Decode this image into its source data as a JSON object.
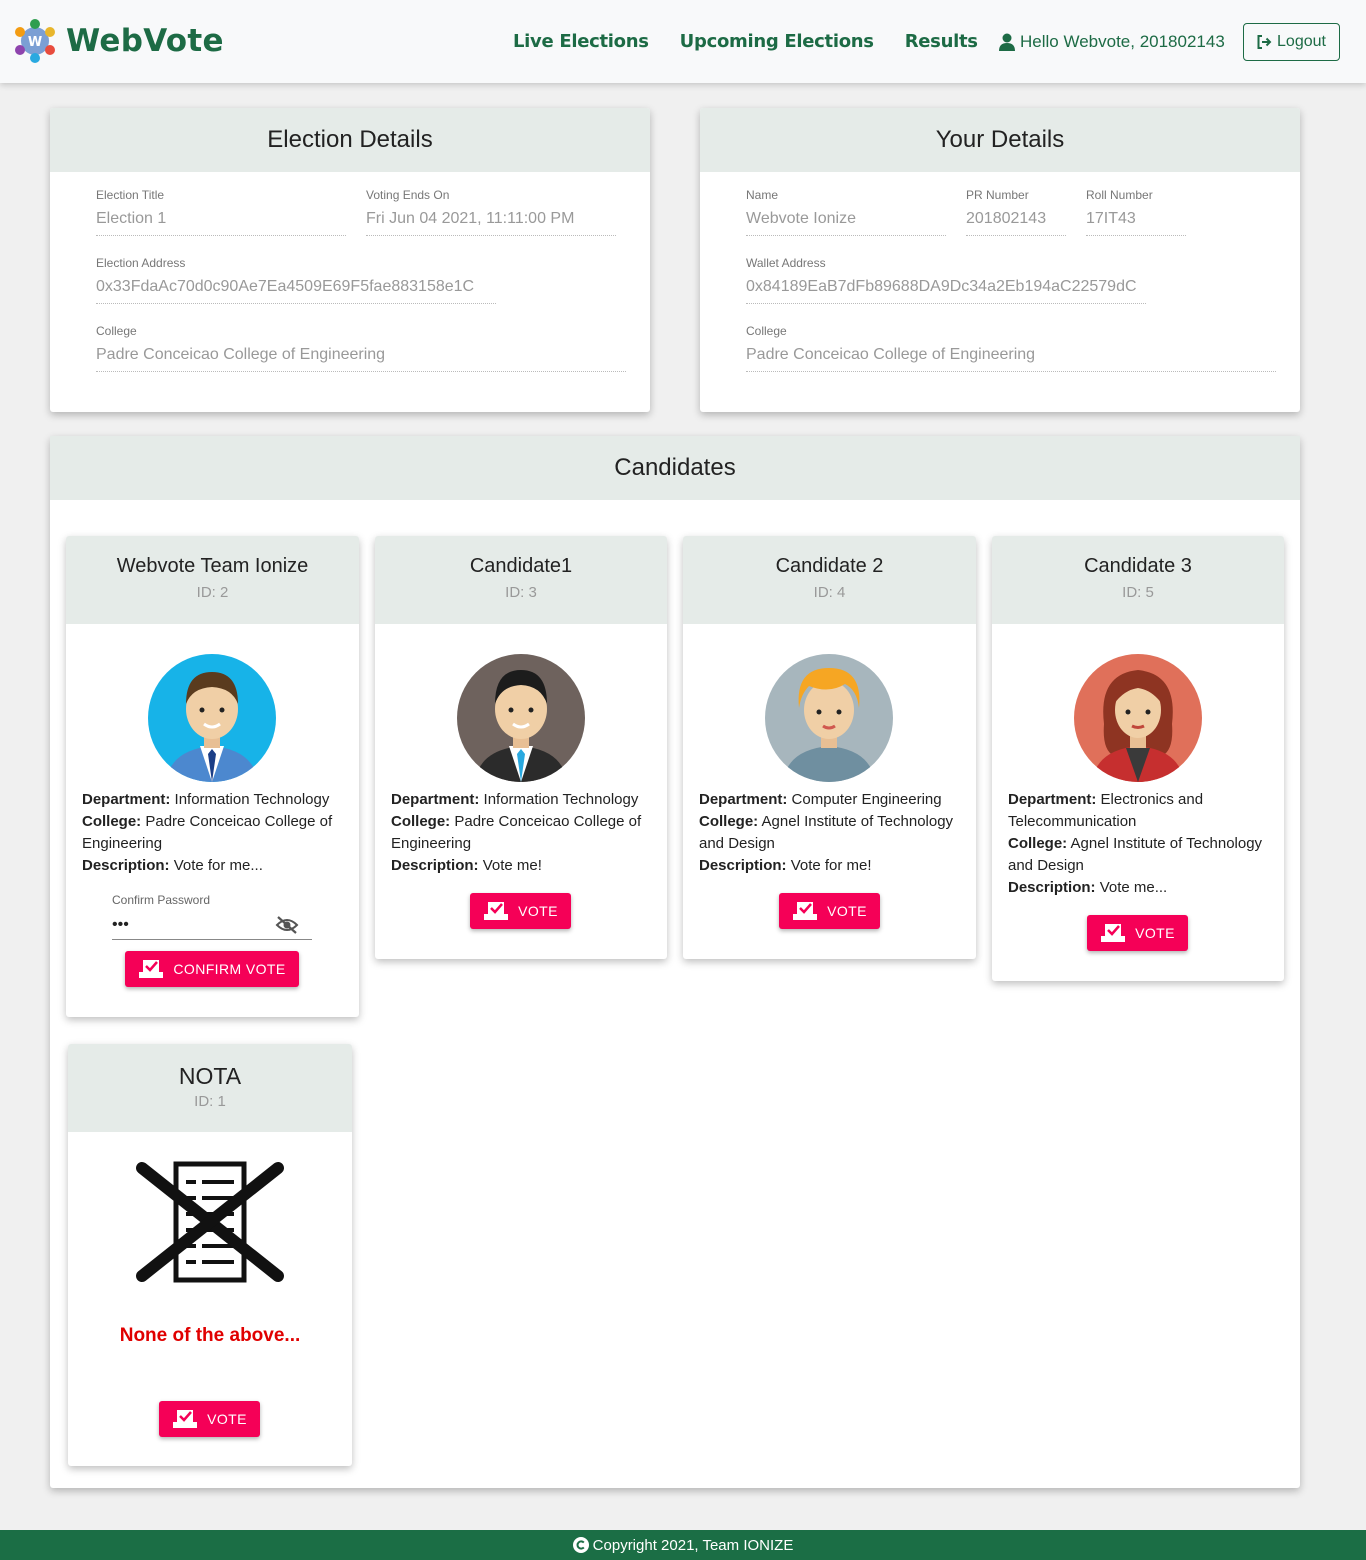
{
  "nav": {
    "brand": "WebVote",
    "links": [
      "Live Elections",
      "Upcoming Elections",
      "Results"
    ],
    "greeting": "Hello Webvote, 201802143",
    "logout": "Logout",
    "brand_color": "#1d6b45"
  },
  "election": {
    "header": "Election Details",
    "title_label": "Election Title",
    "title_value": "Election 1",
    "ends_label": "Voting Ends On",
    "ends_value": "Fri Jun 04 2021, 11:11:00 PM",
    "address_label": "Election Address",
    "address_value": "0x33FdaAc70d0c90Ae7Ea4509E69F5fae883158e1C",
    "college_label": "College",
    "college_value": "Padre Conceicao College of Engineering"
  },
  "user": {
    "header": "Your Details",
    "name_label": "Name",
    "name_value": "Webvote Ionize",
    "pr_label": "PR Number",
    "pr_value": "201802143",
    "roll_label": "Roll Number",
    "roll_value": "17IT43",
    "wallet_label": "Wallet Address",
    "wallet_value": "0x84189EaB7dFb89688DA9Dc34a2Eb194aC22579dC",
    "college_label": "College",
    "college_value": "Padre Conceicao College of Engineering"
  },
  "candidates": {
    "header": "Candidates",
    "dept_label": "Department:",
    "college_label": "College:",
    "desc_label": "Description:",
    "items": [
      {
        "name": "Webvote Team Ionize",
        "id": "ID: 2",
        "department": "Information Technology",
        "college": "Padre Conceicao College of Engineering",
        "description": "Vote for me...",
        "confirm_label": "Confirm Password",
        "confirm_value": "•••",
        "button": "CONFIRM VOTE"
      },
      {
        "name": "Candidate1",
        "id": "ID: 3",
        "department": "Information Technology",
        "college": "Padre Conceicao College of Engineering",
        "description": "Vote me!",
        "button": "VOTE"
      },
      {
        "name": "Candidate 2",
        "id": "ID: 4",
        "department": "Computer Engineering",
        "college": "Agnel Institute of Technology and Design",
        "description": "Vote for me!",
        "button": "VOTE"
      },
      {
        "name": "Candidate 3",
        "id": "ID: 5",
        "department": "Electronics and Telecommunication",
        "college": "Agnel Institute of Technology and Design",
        "description": "Vote me...",
        "button": "VOTE"
      }
    ],
    "nota": {
      "name": "NOTA",
      "id": "ID: 1",
      "text": "None of the above...",
      "button": "VOTE"
    },
    "accent_color": "#f50057"
  },
  "footer": {
    "text": "Copyright 2021, Team IONIZE"
  }
}
